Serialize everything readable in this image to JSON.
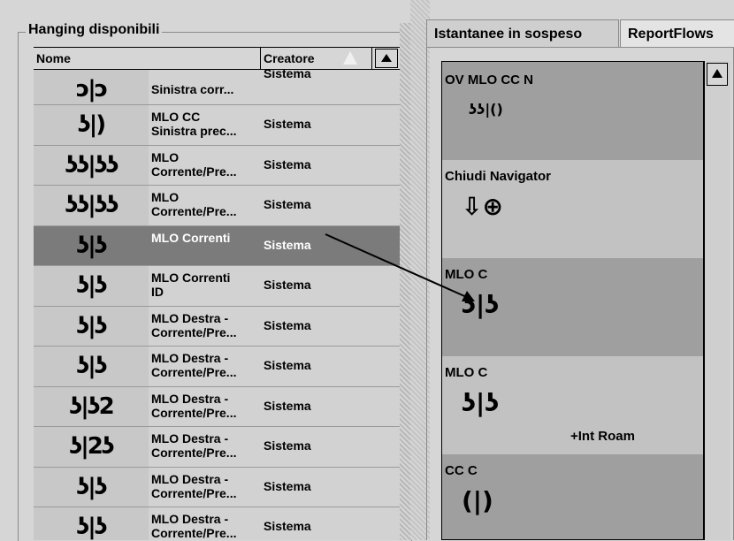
{
  "left_panel": {
    "title": "Hanging disponibili",
    "columns": {
      "name": "Nome",
      "creator": "Creatore"
    },
    "rows": [
      {
        "name": "Sinistra corr...",
        "creator": "Sistema",
        "thumb": "ↄ|ↄ",
        "partial": true
      },
      {
        "name": "MLO CC\nSinistra prec...",
        "creator": "Sistema",
        "thumb": "ʖ|)"
      },
      {
        "name": "MLO\nCorrente/Pre...",
        "creator": "Sistema",
        "thumb": "ʖʖ|ʖʖ"
      },
      {
        "name": "MLO\nCorrente/Pre...",
        "creator": "Sistema",
        "thumb": "ʖʖ|ʖʖ"
      },
      {
        "name": "MLO Correnti",
        "creator": "Sistema",
        "thumb": "ʖ|ʖ",
        "selected": true
      },
      {
        "name": "MLO Correnti\nID",
        "creator": "Sistema",
        "thumb": "ʖ|ʖ"
      },
      {
        "name": "MLO Destra -\nCorrente/Pre...",
        "creator": "Sistema",
        "thumb": "ʖ|ʖ"
      },
      {
        "name": "MLO Destra -\nCorrente/Pre...",
        "creator": "Sistema",
        "thumb": "ʖ|ʖ"
      },
      {
        "name": "MLO Destra -\nCorrente/Pre...",
        "creator": "Sistema",
        "thumb": "ʖ|ʖ2"
      },
      {
        "name": "MLO Destra -\nCorrente/Pre...",
        "creator": "Sistema",
        "thumb": "ʖ|2ʖ"
      },
      {
        "name": "MLO Destra -\nCorrente/Pre...",
        "creator": "Sistema",
        "thumb": "ʖ|ʖ"
      },
      {
        "name": "MLO Destra -\nCorrente/Pre...",
        "creator": "Sistema",
        "thumb": "ʖ|ʖ"
      }
    ]
  },
  "right_panel": {
    "tabs": [
      "Istantanee in sospeso",
      "ReportFlows"
    ],
    "items": [
      {
        "label": "OV MLO CC N",
        "thumb": "ʖʖ|()"
      },
      {
        "label": "Chiudi Navigator",
        "thumb": "⇩⊕"
      },
      {
        "label": "MLO C",
        "thumb": "ʖ|ʖ"
      },
      {
        "label": "MLO C",
        "thumb": "ʖ|ʖ",
        "extra": "+Int Roam"
      },
      {
        "label": "CC C",
        "thumb": "(|)"
      }
    ]
  }
}
